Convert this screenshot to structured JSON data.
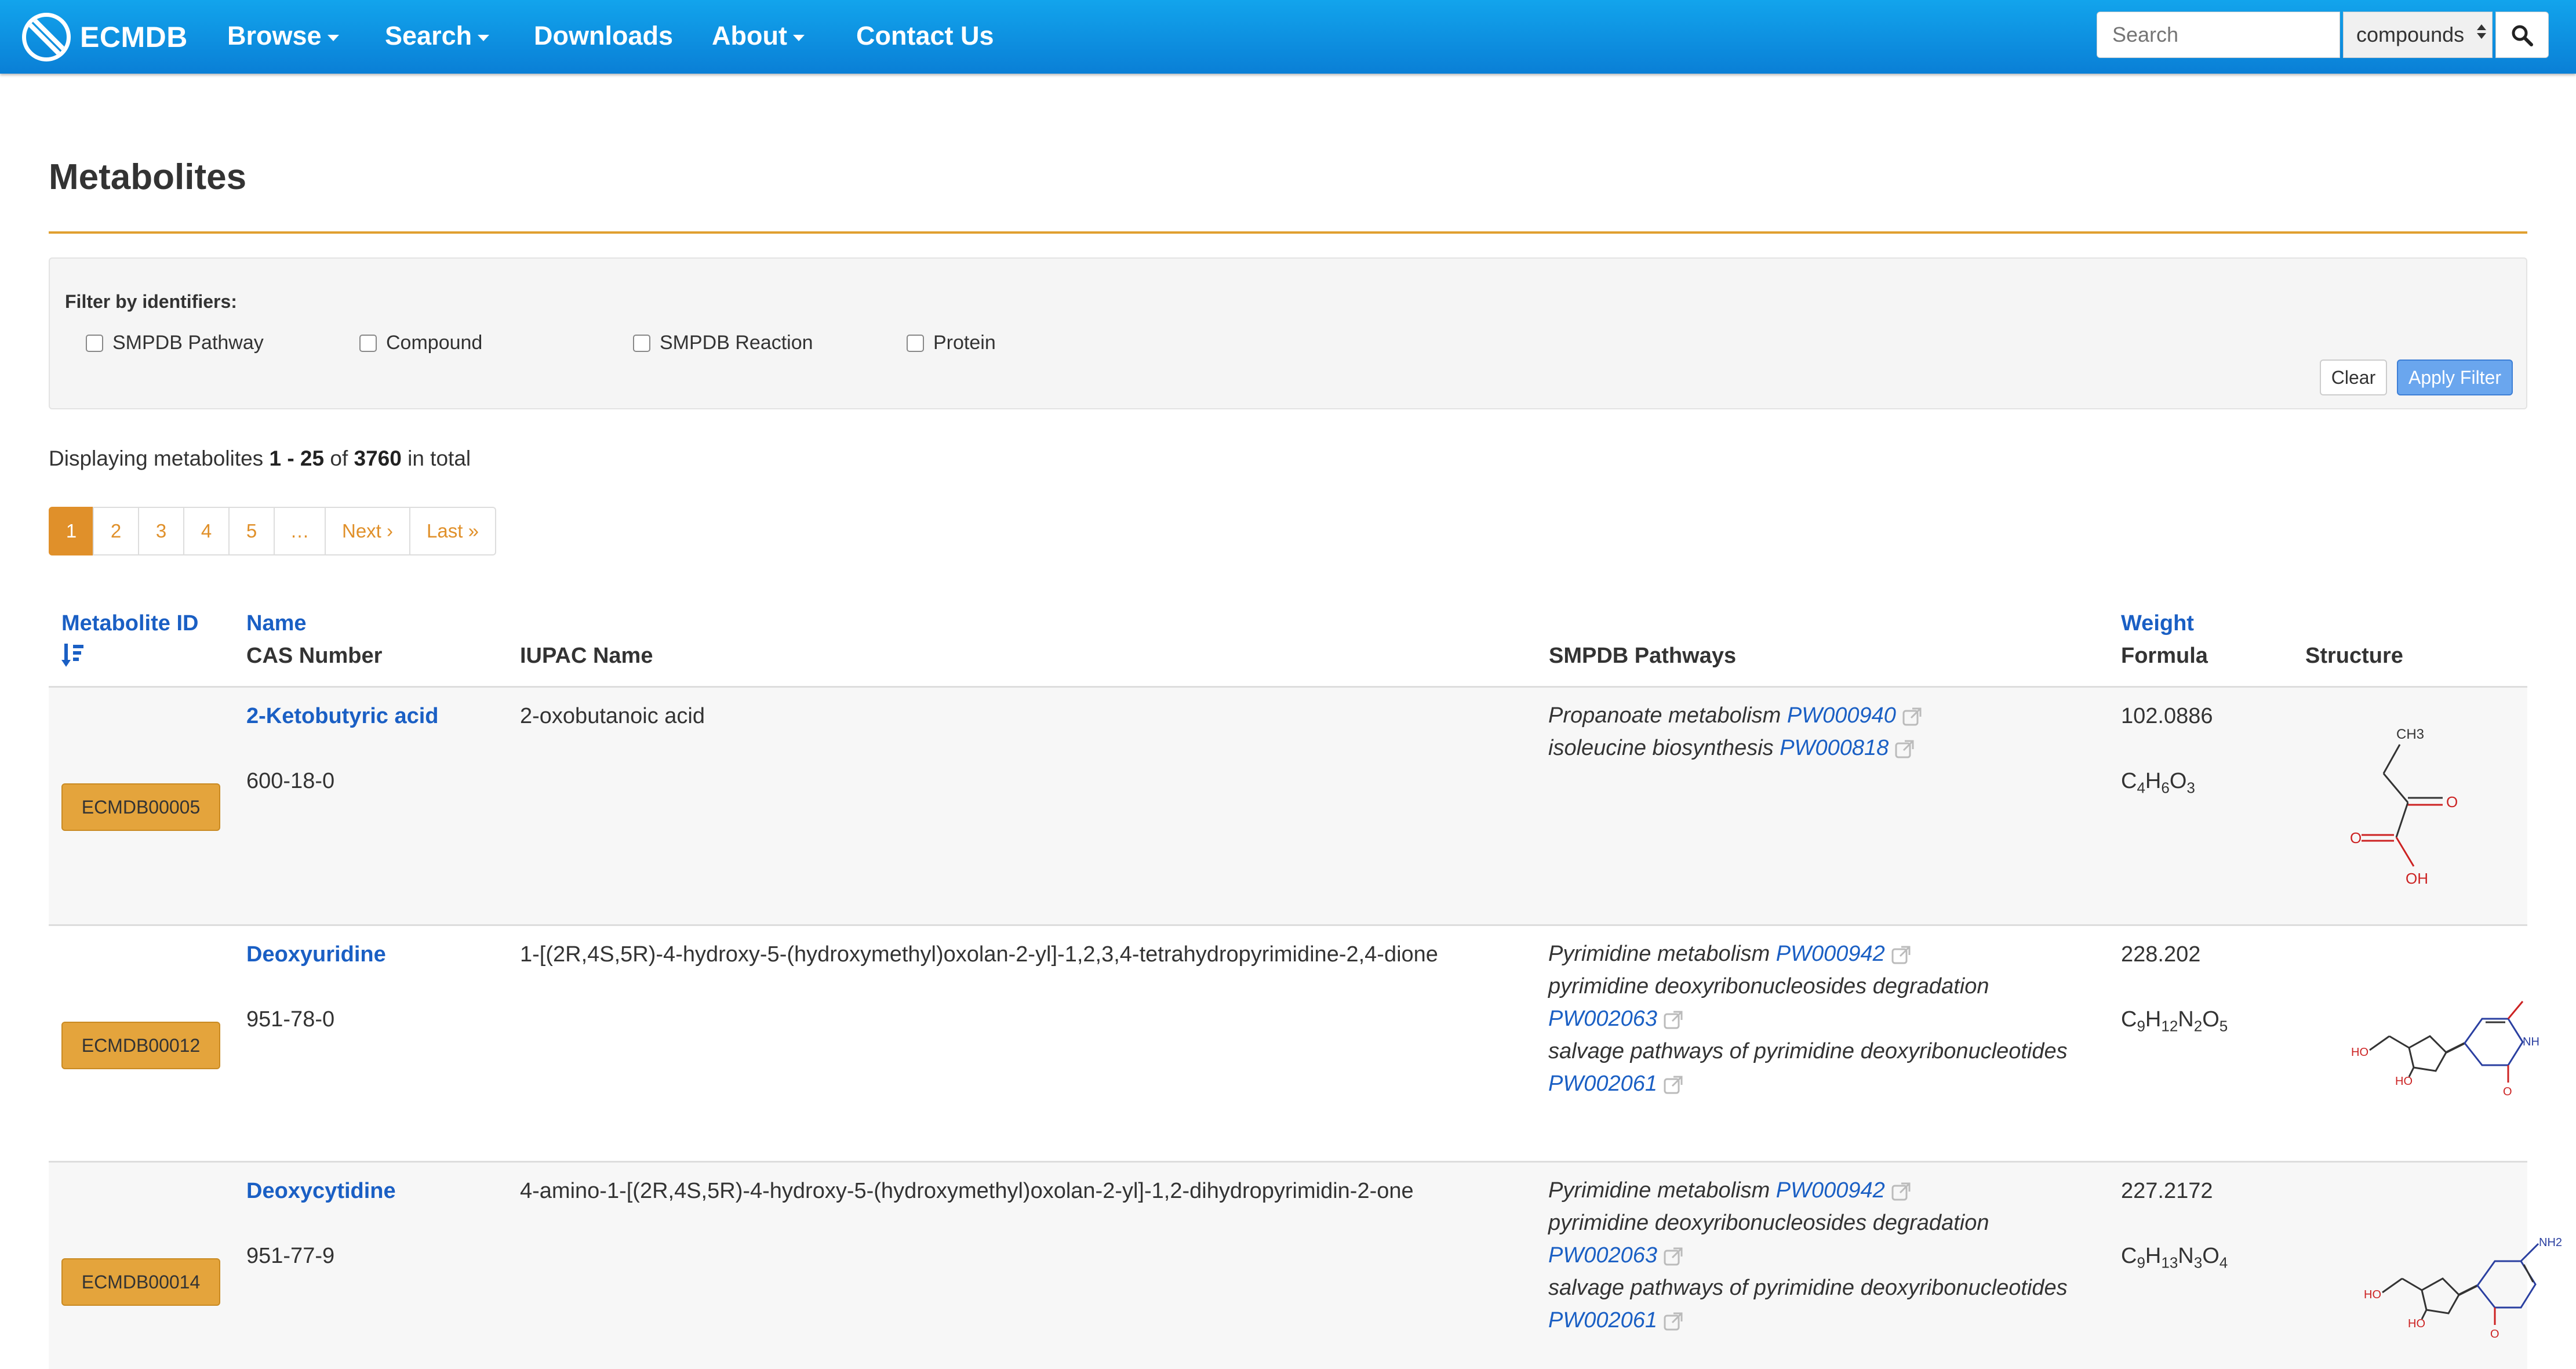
{
  "navbar": {
    "brand": "ECMDB",
    "items": [
      {
        "label": "Browse",
        "has_caret": true
      },
      {
        "label": "Search",
        "has_caret": true
      },
      {
        "label": "Downloads",
        "has_caret": false
      },
      {
        "label": "About",
        "has_caret": true
      },
      {
        "label": "Contact Us",
        "has_caret": false
      }
    ],
    "search_placeholder": "Search",
    "search_scope": "compounds"
  },
  "page": {
    "title": "Metabolites",
    "accent_color": "#e0a030"
  },
  "filter": {
    "label": "Filter by identifiers:",
    "options": [
      "SMPDB Pathway",
      "Compound",
      "SMPDB Reaction",
      "Protein"
    ],
    "clear_label": "Clear",
    "apply_label": "Apply Filter"
  },
  "summary": {
    "prefix": "Displaying metabolites",
    "range": "1 - 25",
    "of": "of",
    "total": "3760",
    "suffix": "in total"
  },
  "pagination": {
    "pages": [
      "1",
      "2",
      "3",
      "4",
      "5",
      "…",
      "Next ›",
      "Last »"
    ],
    "active": "1"
  },
  "table": {
    "headers": {
      "metabolite_id": "Metabolite ID",
      "name": "Name",
      "cas_number": "CAS Number",
      "iupac_name": "IUPAC Name",
      "smpdb_pathways": "SMPDB Pathways",
      "weight": "Weight",
      "formula": "Formula",
      "structure": "Structure"
    },
    "rows": [
      {
        "id": "ECMDB00005",
        "name": "2-Ketobutyric acid",
        "cas": "600-18-0",
        "iupac": "2-oxobutanoic acid",
        "pathways": [
          {
            "name": "Propanoate metabolism",
            "id": "PW000940"
          },
          {
            "name": "isoleucine biosynthesis",
            "id": "PW000818"
          }
        ],
        "weight": "102.0886",
        "formula": {
          "C": "C",
          "c_n": "4",
          "H": "H",
          "h_n": "6",
          "O": "O",
          "o_n": "3"
        },
        "structure_labels": {
          "ch3": "CH3",
          "o1": "O",
          "o2": "O",
          "oh": "OH"
        }
      },
      {
        "id": "ECMDB00012",
        "name": "Deoxyuridine",
        "cas": "951-78-0",
        "iupac": "1-[(2R,4S,5R)-4-hydroxy-5-(hydroxymethyl)oxolan-2-yl]-1,2,3,4-tetrahydropyrimidine-2,4-dione",
        "pathways": [
          {
            "name": "Pyrimidine metabolism",
            "id": "PW000942"
          },
          {
            "name": "pyrimidine deoxyribonucleosides degradation",
            "id": "PW002063"
          },
          {
            "name": "salvage pathways of pyrimidine deoxyribonucleotides",
            "id": "PW002061"
          }
        ],
        "weight": "228.202",
        "formula": {
          "C": "C",
          "c_n": "9",
          "H": "H",
          "h_n": "12",
          "N": "N",
          "n_n": "2",
          "O": "O",
          "o_n": "5"
        },
        "structure_labels": {
          "ho1": "HO",
          "ho2": "HO",
          "nh": "NH",
          "o": "O"
        }
      },
      {
        "id": "ECMDB00014",
        "name": "Deoxycytidine",
        "cas": "951-77-9",
        "iupac": "4-amino-1-[(2R,4S,5R)-4-hydroxy-5-(hydroxymethyl)oxolan-2-yl]-1,2-dihydropyrimidin-2-one",
        "pathways": [
          {
            "name": "Pyrimidine metabolism",
            "id": "PW000942"
          },
          {
            "name": "pyrimidine deoxyribonucleosides degradation",
            "id": "PW002063"
          },
          {
            "name": "salvage pathways of pyrimidine deoxyribonucleotides",
            "id": "PW002061"
          }
        ],
        "weight": "227.2172",
        "formula": {
          "C": "C",
          "c_n": "9",
          "H": "H",
          "h_n": "13",
          "N": "N",
          "n_n": "3",
          "O": "O",
          "o_n": "4"
        },
        "structure_labels": {
          "ho1": "HO",
          "ho2": "HO",
          "nh2": "NH2",
          "o": "O"
        }
      }
    ]
  },
  "colors": {
    "navbar": "#0a8fe0",
    "link": "#1a5fc4",
    "id_button": "#e4a43c",
    "apply_button": "#6aa6ee",
    "page_active": "#e0902a"
  }
}
